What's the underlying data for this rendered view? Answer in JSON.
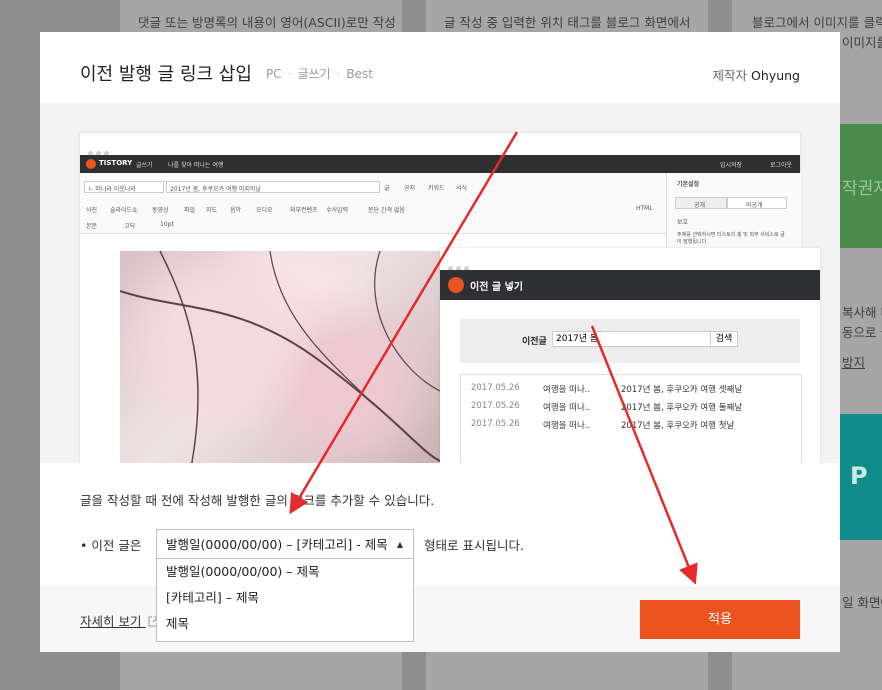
{
  "background": {
    "snippets": [
      "댓글 또는 방명록의 내용이 영어(ASCII)로만 작성",
      "글 작성 중 입력한 위치 태그를 블로그 화면에서",
      "블로그에서 이미지를 클릭",
      "이미지를",
      "작권자",
      "복사해 다",
      "동으로 글",
      "방지",
      "P",
      "일 화면에"
    ]
  },
  "modal": {
    "title": "이전 발행 글 링크 삽입",
    "tags": [
      "PC",
      "글쓰기",
      "Best"
    ],
    "author_label": "제작자",
    "author_name": "Ohyung",
    "description": "글을 작성할 때 전에 작성해 발행한 글의 링크를 추가할 수 있습니다.",
    "option_prefix": "• 이전 글은",
    "option_suffix": "형태로 표시됩니다.",
    "select_value": "발행일(0000/00/00) – [카테고리] - 제목",
    "select_options": [
      "발행일(0000/00/00) – 제목",
      "[카테고리] – 제목",
      "제목"
    ],
    "more_link": "자세히 보기",
    "apply_button": "적용",
    "colors": {
      "accent": "#eb531f",
      "arrow": "#e52a2a"
    }
  },
  "preview": {
    "editor": {
      "brand": "TISTORY",
      "brand_sub": "글쓰기",
      "tab": "나를 찾아 떠나는 여행",
      "save_btn": "임시저장",
      "logout_btn": "로그아웃",
      "category": "ㄴ 떠나라 이웃나라",
      "post_title": "2017년 봄, 후쿠오카 여행 미지막날",
      "radio_options": [
        "글",
        "공지",
        "키워드",
        "서식"
      ],
      "toolbar": [
        "사진",
        "슬라이드쇼",
        "동영상",
        "파일",
        "지도",
        "음악",
        "오디오",
        "외부컨텐츠",
        "수식입력",
        "문단 간격 없음",
        "HTML"
      ],
      "font_select": "본문",
      "font_face": "고딕",
      "font_size": "10pt",
      "side_title": "기본설정",
      "side_public": "공개",
      "side_private": "비공개",
      "side_protect": "보호",
      "side_note": "주제를 선택하시면 티스토리 홈 및 외부 서비스로 글이 발행됩니다."
    },
    "dialog": {
      "title": "이전 글 넣기",
      "search_label": "이전글",
      "search_value": "2017년 봄",
      "search_button": "검색",
      "rows": [
        {
          "date": "2017.05.26",
          "category": "여행을 떠나..",
          "title": "2017년 봄, 후쿠오카 여행 셋째날"
        },
        {
          "date": "2017.05.26",
          "category": "여행을 떠나..",
          "title": "2017년 봄, 후쿠오카 여행 둘째날"
        },
        {
          "date": "2017.05.26",
          "category": "여행을 떠나..",
          "title": "2017년 봄, 후쿠오카 여행 첫날"
        }
      ]
    }
  }
}
